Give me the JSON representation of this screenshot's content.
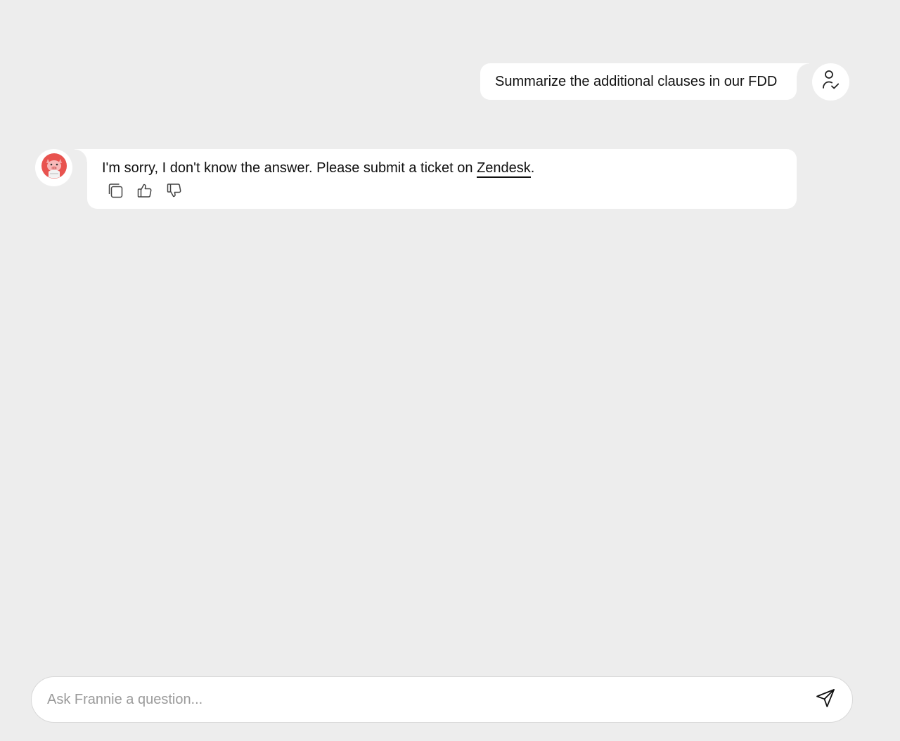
{
  "conversation": {
    "user_message": "Summarize the additional clauses in our FDD",
    "bot_message": {
      "text_before": "I'm sorry, I don't know the answer. Please submit a ticket on ",
      "link_text": "Zendesk",
      "text_after": "."
    }
  },
  "icons": {
    "user_avatar": "user-check-icon",
    "bot_avatar": "bot-mascot-icon",
    "copy": "copy-icon",
    "thumbs_up": "thumbs-up-icon",
    "thumbs_down": "thumbs-down-icon",
    "send": "send-icon"
  },
  "composer": {
    "placeholder": "Ask Frannie a question...",
    "value": ""
  },
  "colors": {
    "background": "#ededed",
    "bubble": "#ffffff",
    "avatar_accent": "#e8534f"
  }
}
